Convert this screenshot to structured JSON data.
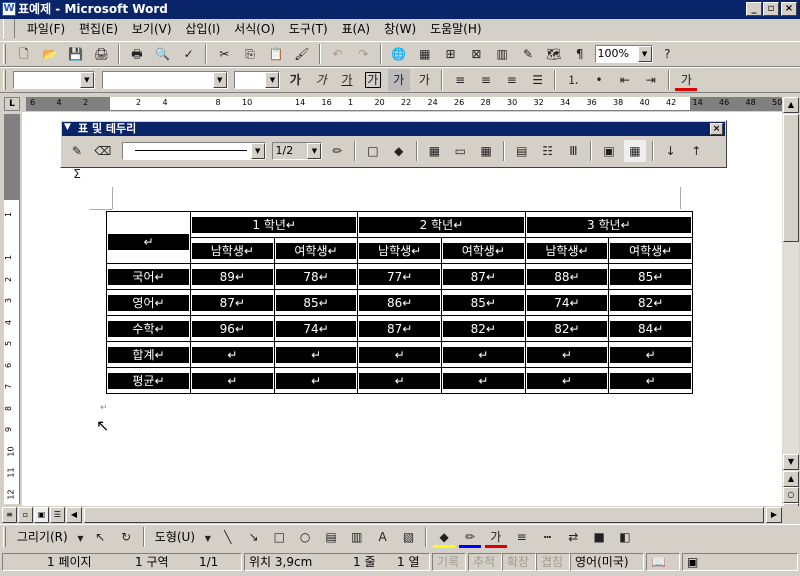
{
  "window": {
    "title": "표예제 - Microsoft Word",
    "minimize": "_",
    "restore": "▫",
    "close": "×"
  },
  "menu": [
    "파일(F)",
    "편집(E)",
    "보기(V)",
    "삽입(I)",
    "서식(O)",
    "도구(T)",
    "표(A)",
    "창(W)",
    "도움말(H)"
  ],
  "standard_toolbar": {
    "zoom": "100%"
  },
  "format_toolbar": {
    "style": "",
    "font": "",
    "size": "",
    "bold": "가",
    "italic": "가",
    "underline": "가",
    "char_border": "가",
    "char_shade": "가",
    "char_scale": "가",
    "font_color": "가"
  },
  "ruler_h": [
    "6",
    "4",
    "2",
    "",
    "2",
    "4",
    "",
    "8",
    "10",
    "",
    "14",
    "16",
    "1",
    "20",
    "22",
    "24",
    "26",
    "28",
    "30",
    "32",
    "34",
    "36",
    "38",
    "40",
    "42",
    "14",
    "46",
    "48",
    "50"
  ],
  "ruler_v": [
    "1",
    "",
    "1",
    "2",
    "3",
    "4",
    "5",
    "6",
    "7",
    "8",
    "9",
    "10",
    "11",
    "12"
  ],
  "tables_toolbar": {
    "title": "표 및 테두리",
    "line_weight": "1/2",
    "sum": "Σ"
  },
  "table": {
    "corner": "↵",
    "grades": [
      "1 학년↵",
      "2 학년↵",
      "3 학년↵"
    ],
    "sub": [
      "남학생↵",
      "여학생↵",
      "남학생↵",
      "여학생↵",
      "남학생↵",
      "여학생↵"
    ],
    "rows": [
      {
        "label": "국어↵",
        "values": [
          "89↵",
          "78↵",
          "77↵",
          "87↵",
          "88↵",
          "85↵"
        ]
      },
      {
        "label": "영어↵",
        "values": [
          "87↵",
          "85↵",
          "86↵",
          "85↵",
          "74↵",
          "82↵"
        ]
      },
      {
        "label": "수학↵",
        "values": [
          "96↵",
          "74↵",
          "87↵",
          "82↵",
          "82↵",
          "84↵"
        ]
      },
      {
        "label": "합계↵",
        "values": [
          "↵",
          "↵",
          "↵",
          "↵",
          "↵",
          "↵"
        ]
      },
      {
        "label": "평균↵",
        "values": [
          "↵",
          "↵",
          "↵",
          "↵",
          "↵",
          "↵"
        ]
      }
    ],
    "row_end": "↵",
    "after": "↵"
  },
  "drawing_toolbar": {
    "draw": "그리기(R)",
    "shapes": "도형(U)",
    "font_color": "가"
  },
  "status": {
    "page": "1 페이지",
    "section": "1 구역",
    "pages": "1/1",
    "position": "위치 3,9cm",
    "line": "1 줄",
    "col": "1 열",
    "rec": "기록",
    "trk": "추적",
    "ext": "확장",
    "ovr": "겹침",
    "lang": "영어(미국)"
  }
}
